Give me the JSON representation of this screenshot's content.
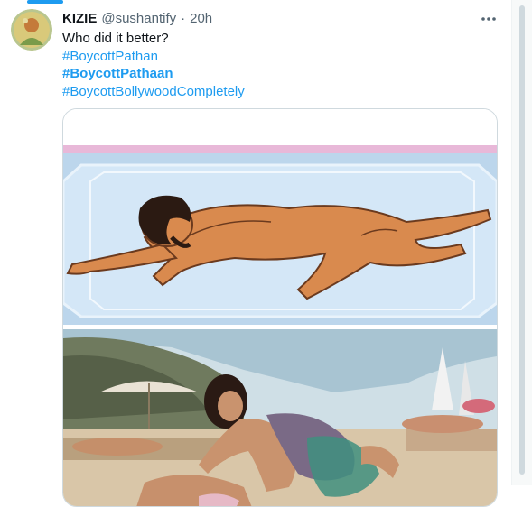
{
  "tweet": {
    "display_name": "KIZIE",
    "handle": "@sushantify",
    "separator": "·",
    "time": "20h",
    "text": "Who did it better?",
    "hashtags": [
      {
        "text": "#BoycottPathan",
        "bold": false
      },
      {
        "text": "#BoycottPathaan",
        "bold": true
      },
      {
        "text": "#BoycottBollywoodCompletely",
        "bold": false
      }
    ]
  },
  "colors": {
    "link": "#1d9bf0",
    "secondary_text": "#536471",
    "border": "#cfd9de"
  },
  "icons": {
    "more": "more-dots-icon",
    "avatar": "avatar-image"
  }
}
